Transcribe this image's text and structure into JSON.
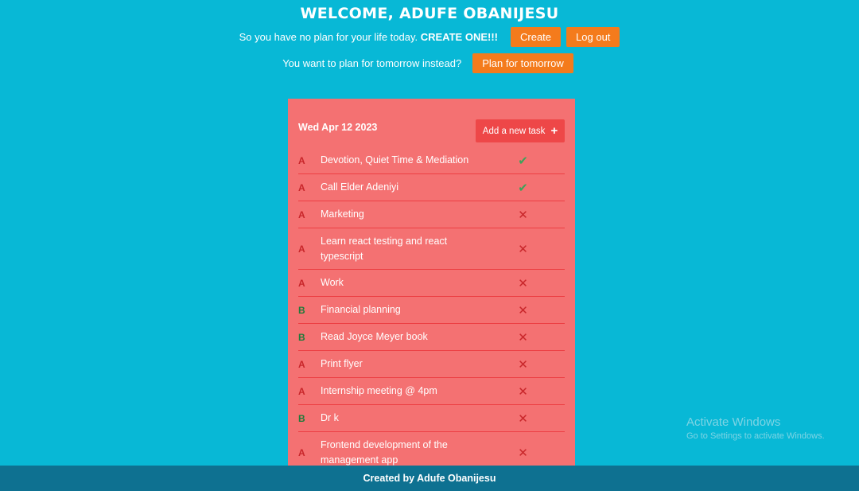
{
  "header": {
    "welcome": "WELCOME, ADUFE OBANIJESU",
    "prompt_text": "So you have no plan for your life today.",
    "prompt_emphasis": "CREATE ONE!!!",
    "create_label": "Create",
    "logout_label": "Log out",
    "tomorrow_text": "You want to plan for tomorrow instead?",
    "tomorrow_label": "Plan for tomorrow"
  },
  "card": {
    "date": "Wed Apr 12 2023",
    "add_label": "Add a new task",
    "tasks": [
      {
        "priority": "A",
        "name": "Devotion, Quiet Time & Mediation",
        "status": "done"
      },
      {
        "priority": "A",
        "name": "Call Elder Adeniyi",
        "status": "done"
      },
      {
        "priority": "A",
        "name": "Marketing",
        "status": "todo"
      },
      {
        "priority": "A",
        "name": "Learn react testing and react typescript",
        "status": "todo"
      },
      {
        "priority": "A",
        "name": "Work",
        "status": "todo"
      },
      {
        "priority": "B",
        "name": "Financial planning",
        "status": "todo"
      },
      {
        "priority": "B",
        "name": "Read Joyce Meyer book",
        "status": "todo"
      },
      {
        "priority": "A",
        "name": "Print flyer",
        "status": "todo"
      },
      {
        "priority": "A",
        "name": "Internship meeting @ 4pm",
        "status": "todo"
      },
      {
        "priority": "B",
        "name": "Dr k",
        "status": "todo"
      },
      {
        "priority": "A",
        "name": "Frontend development of the management app",
        "status": "todo"
      }
    ]
  },
  "footer": {
    "text": "Created by Adufe Obanijesu"
  },
  "watermark": {
    "line1": "Activate Windows",
    "line2": "Go to Settings to activate Windows."
  },
  "colors": {
    "background": "#08b8d6",
    "accent": "#f47b1c",
    "card": "#f47172",
    "footer": "#0e7191"
  },
  "icons": {
    "done": "check-icon",
    "todo": "x-icon",
    "add": "plus-icon"
  }
}
